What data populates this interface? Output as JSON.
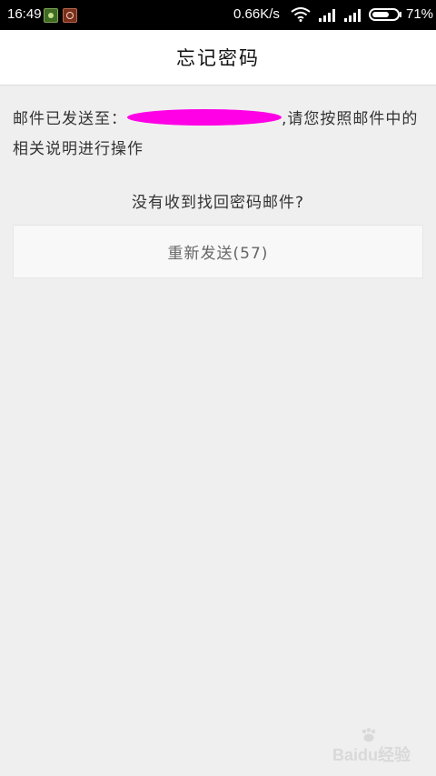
{
  "status_bar": {
    "time": "16:49",
    "network_speed": "0.66K/s",
    "battery_percent": "71%",
    "battery_level": 0.71
  },
  "header": {
    "title": "忘记密码"
  },
  "main": {
    "message_prefix": "邮件已发送至：",
    "message_suffix": ",请您按照邮件中的相关说明进行操作",
    "question": "没有收到找回密码邮件?",
    "resend_button_label": "重新发送(57)"
  },
  "watermark": {
    "text": "Baidu经验"
  },
  "colors": {
    "status_bar": "#000000",
    "background": "#efefef",
    "redaction": "#ff00e6"
  }
}
